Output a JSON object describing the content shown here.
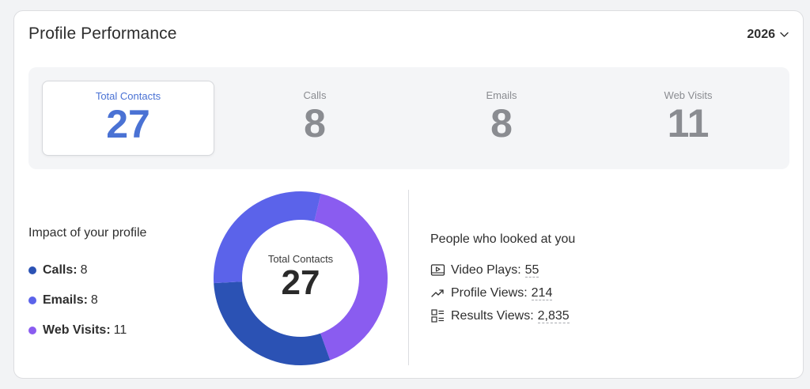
{
  "header": {
    "title": "Profile Performance",
    "year": "2026"
  },
  "stats": [
    {
      "label": "Total Contacts",
      "value": "27",
      "active": true
    },
    {
      "label": "Calls",
      "value": "8"
    },
    {
      "label": "Emails",
      "value": "8"
    },
    {
      "label": "Web Visits",
      "value": "11"
    }
  ],
  "impact": {
    "title": "Impact of your profile",
    "items": [
      {
        "label": "Calls:",
        "value": "8",
        "color": "#2b52b4"
      },
      {
        "label": "Emails:",
        "value": "8",
        "color": "#5b63ea"
      },
      {
        "label": "Web Visits:",
        "value": "11",
        "color": "#8a5cf0"
      }
    ]
  },
  "chart_data": {
    "type": "pie",
    "categories": [
      "Web Visits",
      "Calls",
      "Emails"
    ],
    "values": [
      11,
      8,
      8
    ],
    "colors": [
      "#8a5cf0",
      "#2b52b4",
      "#5b63ea"
    ],
    "center_label": "Total Contacts",
    "center_value": "27"
  },
  "people": {
    "title": "People who looked at you",
    "items": [
      {
        "icon": "video-play-icon",
        "label": "Video Plays:",
        "value": "55"
      },
      {
        "icon": "trending-up-icon",
        "label": "Profile Views:",
        "value": "214"
      },
      {
        "icon": "results-list-icon",
        "label": "Results Views:",
        "value": "2,835"
      }
    ]
  }
}
